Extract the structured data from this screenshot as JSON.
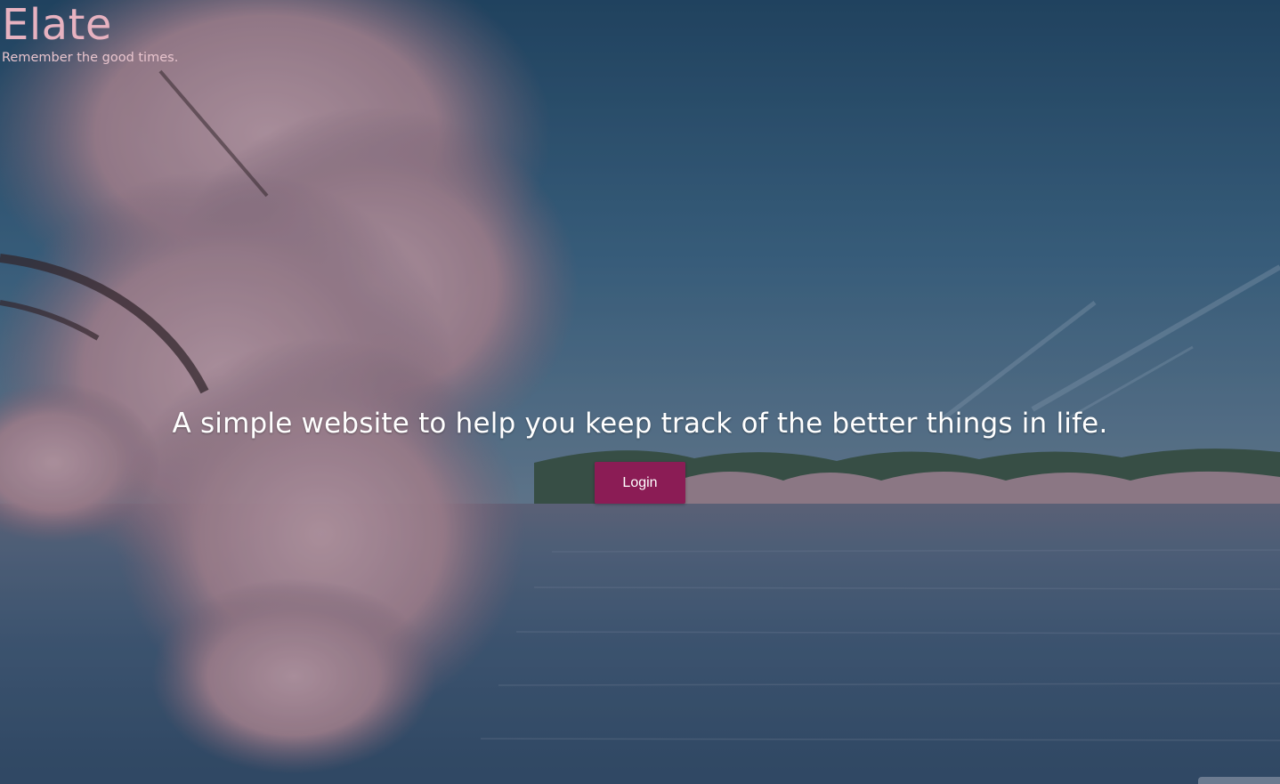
{
  "brand": {
    "title": "Elate",
    "tagline": "Remember the good times."
  },
  "hero": {
    "headline": "A simple website to help you keep track of the better things in life.",
    "login_label": "Login"
  },
  "colors": {
    "brand_pink": "#e7b2c0",
    "button_bg": "#8b1c55",
    "sky": "#2f5a78",
    "water": "#3d5d7a",
    "blossom": "#c7a4ae"
  },
  "background": {
    "icon": "cherry-blossom-lake-photo"
  }
}
